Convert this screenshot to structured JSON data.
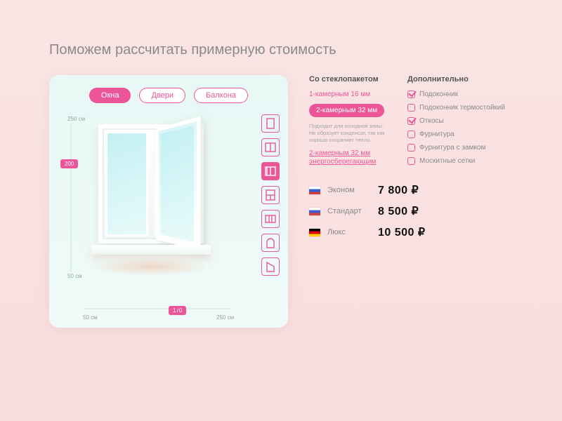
{
  "title": "Поможем рассчитать примерную стоимость",
  "tabs": [
    {
      "label": "Окна",
      "active": true
    },
    {
      "label": "Двери",
      "active": false
    },
    {
      "label": "Балкона",
      "active": false
    }
  ],
  "height": {
    "min": "50 см",
    "max": "250 см",
    "value": "200"
  },
  "width": {
    "min": "50 см",
    "max": "250 см",
    "value": "170"
  },
  "shapes": [
    {
      "name": "single",
      "active": false
    },
    {
      "name": "double",
      "active": false
    },
    {
      "name": "double-open",
      "active": true
    },
    {
      "name": "t-split",
      "active": false
    },
    {
      "name": "triple",
      "active": false
    },
    {
      "name": "arch",
      "active": false
    },
    {
      "name": "angle",
      "active": false
    }
  ],
  "glass": {
    "heading": "Со стеклопакетом",
    "opt1": "1-камерным 16 мм",
    "opt2": "2-камерным 32 мм",
    "note": "Подходит для холодной зимы. Не образует конденсат, так как хорошо сохраняет тепло.",
    "opt3": "2-камерным 32 мм энергосберегающим"
  },
  "extras": {
    "heading": "Дополнительно",
    "items": [
      {
        "label": "Подоконник",
        "checked": true
      },
      {
        "label": "Подоконник термостойкий",
        "checked": false
      },
      {
        "label": "Откосы",
        "checked": true
      },
      {
        "label": "Фурнитура",
        "checked": false
      },
      {
        "label": "Фурнитура с замком",
        "checked": false
      },
      {
        "label": "Москитные сетки",
        "checked": false
      }
    ]
  },
  "prices": [
    {
      "flag": "ru",
      "name": "Эконом",
      "value": "7 800 ₽"
    },
    {
      "flag": "ru",
      "name": "Стандарт",
      "value": "8 500 ₽"
    },
    {
      "flag": "de",
      "name": "Люкс",
      "value": "10 500 ₽"
    }
  ]
}
